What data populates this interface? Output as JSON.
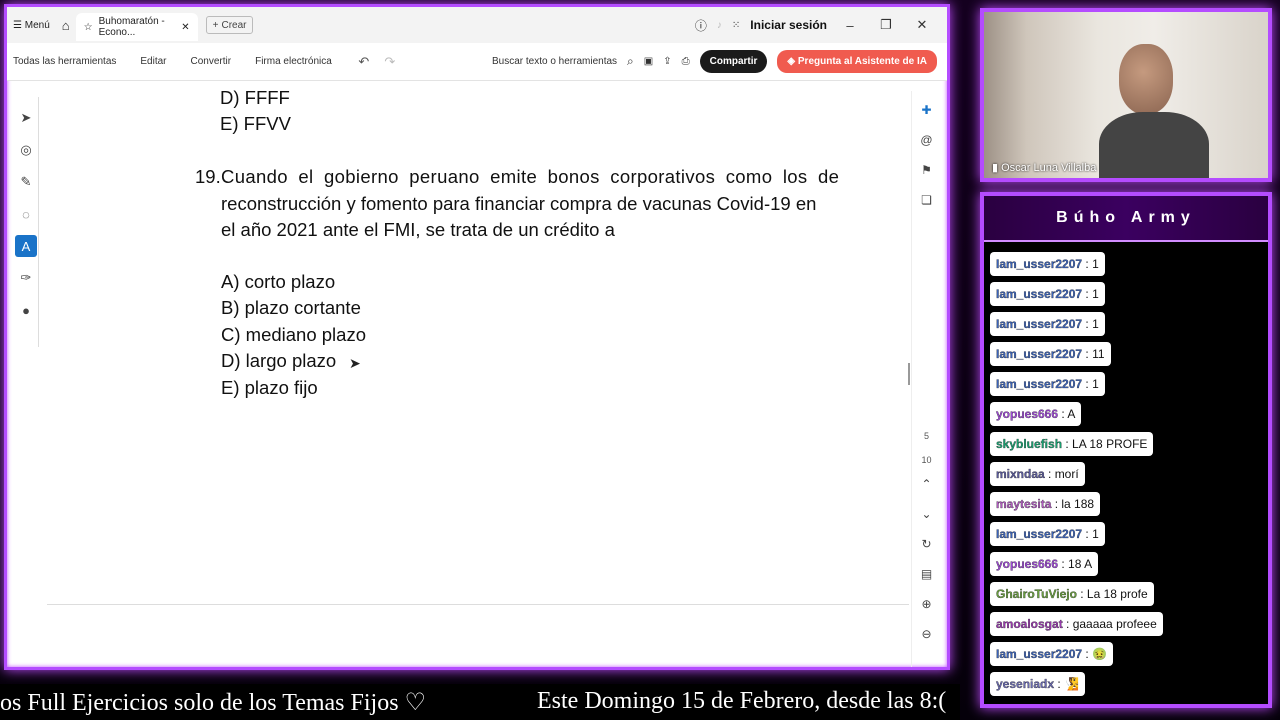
{
  "app": {
    "menu_label": "Menú",
    "tab_title": "Buhomaratón - Econo...",
    "new_tab_label": "Crear",
    "sign_in": "Iniciar sesión"
  },
  "toolbar": {
    "all_tools": "Todas las herramientas",
    "edit": "Editar",
    "convert": "Convertir",
    "sign": "Firma electrónica",
    "search_placeholder": "Buscar texto o herramientas",
    "share": "Compartir",
    "ai": "Pregunta al Asistente de IA"
  },
  "document": {
    "prev_options": [
      "D) FFFF",
      "E) FFVV"
    ],
    "question_number": "19.",
    "question_lines": [
      "Cuando el gobierno peruano emite bonos corporativos como los de",
      "reconstrucción y fomento para financiar compra de vacunas Covid-19 en",
      "el año 2021 ante el FMI, se trata de un crédito a"
    ],
    "options": [
      "A) corto plazo",
      "B) plazo cortante",
      "C) mediano plazo",
      "D) largo plazo",
      "E) plazo fijo"
    ]
  },
  "rail": {
    "page_current": "5",
    "page_total": "10"
  },
  "cam": {
    "name": "Oscar Luna Villalba"
  },
  "chat": {
    "title": "Búho Army",
    "messages": [
      {
        "user": "Iam_usser2207",
        "text": " : 1",
        "color": "#3b63b8"
      },
      {
        "user": "Iam_usser2207",
        "text": " : 1",
        "color": "#3b63b8"
      },
      {
        "user": "Iam_usser2207",
        "text": " : 1",
        "color": "#3b63b8"
      },
      {
        "user": "Iam_usser2207",
        "text": " : 11",
        "color": "#3b63b8"
      },
      {
        "user": "Iam_usser2207",
        "text": " : 1",
        "color": "#3b63b8"
      },
      {
        "user": "yopues666",
        "text": " : A",
        "color": "#a04ad8"
      },
      {
        "user": "skybluefish",
        "text": " : LA 18 PROFE",
        "color": "#19a070"
      },
      {
        "user": "mixndaa",
        "text": " : morí",
        "color": "#5a5a9a"
      },
      {
        "user": "maytesita",
        "text": " : la 188",
        "color": "#b05ac0"
      },
      {
        "user": "Iam_usser2207",
        "text": " : 1",
        "color": "#3b63b8"
      },
      {
        "user": "yopues666",
        "text": " : 18 A",
        "color": "#a04ad8"
      },
      {
        "user": "GhairoTuViejo",
        "text": " : La 18 profe",
        "color": "#6aa040"
      },
      {
        "user": "amoalosgat",
        "text": " : gaaaaa profeee",
        "color": "#9a3ab0"
      },
      {
        "user": "Iam_usser2207",
        "text": " : 🤢",
        "color": "#3b63b8"
      },
      {
        "user": "yeseniadx",
        "text": " : 🧏",
        "color": "#6a6ab0"
      }
    ]
  },
  "ticker": {
    "left": "os Full Ejercicios solo de los Temas Fijos ♡",
    "right": "Este Domingo 15 de Febrero, desde las 8:("
  }
}
